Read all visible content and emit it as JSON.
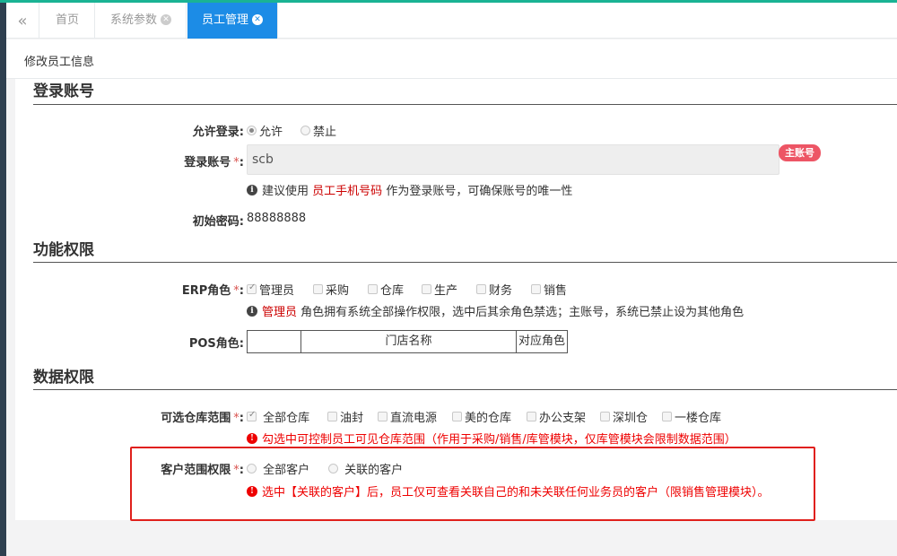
{
  "tabs": [
    {
      "label": "首页",
      "closable": false,
      "active": false
    },
    {
      "label": "系统参数",
      "closable": true,
      "active": false
    },
    {
      "label": "员工管理",
      "closable": true,
      "active": true
    }
  ],
  "page_title": "修改员工信息",
  "sections": {
    "login": "登录账号",
    "function": "功能权限",
    "data": "数据权限"
  },
  "login": {
    "allow_label": "允许登录:",
    "allow_options": [
      "允许",
      "禁止"
    ],
    "account_label": "登录账号",
    "account_value": "scb",
    "main_badge": "主账号",
    "hint_prefix": "建议使用",
    "hint_highlight": "员工手机号码",
    "hint_suffix": "作为登录账号，可确保账号的唯一性",
    "password_label": "初始密码:",
    "password_value": "88888888"
  },
  "function": {
    "erp_label": "ERP角色",
    "roles": [
      {
        "label": "管理员",
        "checked": true
      },
      {
        "label": "采购",
        "checked": false
      },
      {
        "label": "仓库",
        "checked": false
      },
      {
        "label": "生产",
        "checked": false
      },
      {
        "label": "财务",
        "checked": false
      },
      {
        "label": "销售",
        "checked": false
      }
    ],
    "erp_hint_highlight": "管理员",
    "erp_hint_text": "角色拥有系统全部操作权限，选中后其余角色禁选；主账号，系统已禁止设为其他角色",
    "pos_label": "POS角色:",
    "pos_columns": [
      "",
      "门店名称",
      "对应角色"
    ]
  },
  "data": {
    "warehouse_label": "可选仓库范围",
    "warehouses": [
      {
        "label": "全部仓库",
        "checked": true
      },
      {
        "label": "油封",
        "checked": false
      },
      {
        "label": "直流电源",
        "checked": false
      },
      {
        "label": "美的仓库",
        "checked": false
      },
      {
        "label": "办公支架",
        "checked": false
      },
      {
        "label": "深圳仓",
        "checked": false
      },
      {
        "label": "一楼仓库",
        "checked": false
      }
    ],
    "warehouse_hint": "勾选中可控制员工可见仓库范围（作用于采购/销售/库管模块，仅库管模块会限制数据范围）",
    "customer_label": "客户范围权限",
    "customer_options": [
      "全部客户",
      "关联的客户"
    ],
    "customer_hint": "选中【关联的客户】后，员工仅可查看关联自己的和未关联任何业务员的客户（限销售管理模块）。"
  },
  "required_mark": "*",
  "colors": {
    "active_tab": "#1c8ce6",
    "required": "#d9534f",
    "badge": "#ed5565",
    "highlight_box": "#e0201c"
  }
}
